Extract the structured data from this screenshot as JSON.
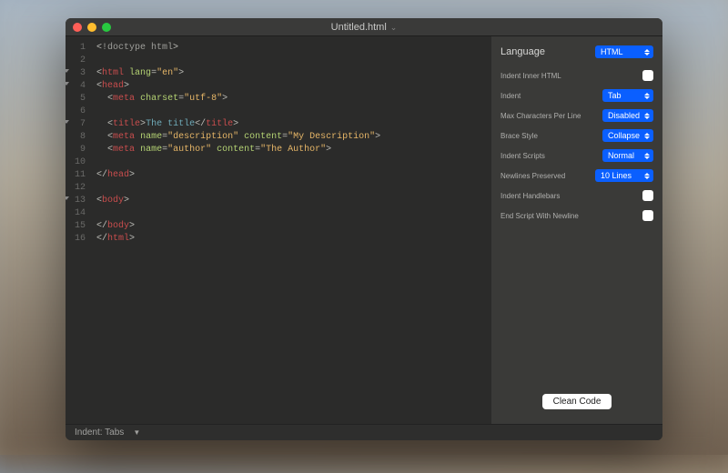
{
  "window": {
    "title": "Untitled.html"
  },
  "code": {
    "lines": [
      {
        "n": 1,
        "fold": false,
        "html": "<span class='t-punc'>&lt;</span><span class='t-doctype'>!doctype html</span><span class='t-punc'>&gt;</span>"
      },
      {
        "n": 2,
        "fold": false,
        "html": ""
      },
      {
        "n": 3,
        "fold": true,
        "html": "<span class='t-punc'>&lt;</span><span class='t-tag'>html</span> <span class='t-attr'>lang</span><span class='t-punc'>=</span><span class='t-str'>\"en\"</span><span class='t-punc'>&gt;</span>"
      },
      {
        "n": 4,
        "fold": true,
        "html": "<span class='t-punc'>&lt;</span><span class='t-tag'>head</span><span class='t-punc'>&gt;</span>"
      },
      {
        "n": 5,
        "fold": false,
        "html": "  <span class='t-punc'>&lt;</span><span class='t-tag'>meta</span> <span class='t-attr'>charset</span><span class='t-punc'>=</span><span class='t-str'>\"utf-8\"</span><span class='t-punc'>&gt;</span>"
      },
      {
        "n": 6,
        "fold": false,
        "html": ""
      },
      {
        "n": 7,
        "fold": true,
        "html": "  <span class='t-punc'>&lt;</span><span class='t-tag'>title</span><span class='t-punc'>&gt;</span><span class='t-text'>The title</span><span class='t-punc'>&lt;/</span><span class='t-tag'>title</span><span class='t-punc'>&gt;</span>"
      },
      {
        "n": 8,
        "fold": false,
        "html": "  <span class='t-punc'>&lt;</span><span class='t-tag'>meta</span> <span class='t-attr'>name</span><span class='t-punc'>=</span><span class='t-str'>\"description\"</span> <span class='t-attr'>content</span><span class='t-punc'>=</span><span class='t-str'>\"My Description\"</span><span class='t-punc'>&gt;</span>"
      },
      {
        "n": 9,
        "fold": false,
        "html": "  <span class='t-punc'>&lt;</span><span class='t-tag'>meta</span> <span class='t-attr'>name</span><span class='t-punc'>=</span><span class='t-str'>\"author\"</span> <span class='t-attr'>content</span><span class='t-punc'>=</span><span class='t-str'>\"The Author\"</span><span class='t-punc'>&gt;</span>"
      },
      {
        "n": 10,
        "fold": false,
        "html": ""
      },
      {
        "n": 11,
        "fold": false,
        "html": "<span class='t-punc'>&lt;/</span><span class='t-tag'>head</span><span class='t-punc'>&gt;</span>"
      },
      {
        "n": 12,
        "fold": false,
        "html": ""
      },
      {
        "n": 13,
        "fold": true,
        "html": "<span class='t-punc'>&lt;</span><span class='t-tag'>body</span><span class='t-punc'>&gt;</span>"
      },
      {
        "n": 14,
        "fold": false,
        "html": ""
      },
      {
        "n": 15,
        "fold": false,
        "html": "<span class='t-punc'>&lt;/</span><span class='t-tag'>body</span><span class='t-punc'>&gt;</span>"
      },
      {
        "n": 16,
        "fold": false,
        "html": "<span class='t-punc'>&lt;/</span><span class='t-tag'>html</span><span class='t-punc'>&gt;</span>"
      }
    ]
  },
  "sidebar": {
    "header_label": "Language",
    "language_value": "HTML",
    "rows": {
      "indent_inner_html": "Indent Inner HTML",
      "indent": "Indent",
      "indent_value": "Tab",
      "max_chars": "Max Characters Per Line",
      "max_chars_value": "Disabled",
      "brace_style": "Brace Style",
      "brace_style_value": "Collapse",
      "indent_scripts": "Indent Scripts",
      "indent_scripts_value": "Normal",
      "newlines_preserved": "Newlines Preserved",
      "newlines_preserved_value": "10 Lines",
      "indent_handlebars": "Indent Handlebars",
      "end_script_newline": "End Script With Newline"
    },
    "clean_button": "Clean Code"
  },
  "statusbar": {
    "indent": "Indent: Tabs"
  }
}
